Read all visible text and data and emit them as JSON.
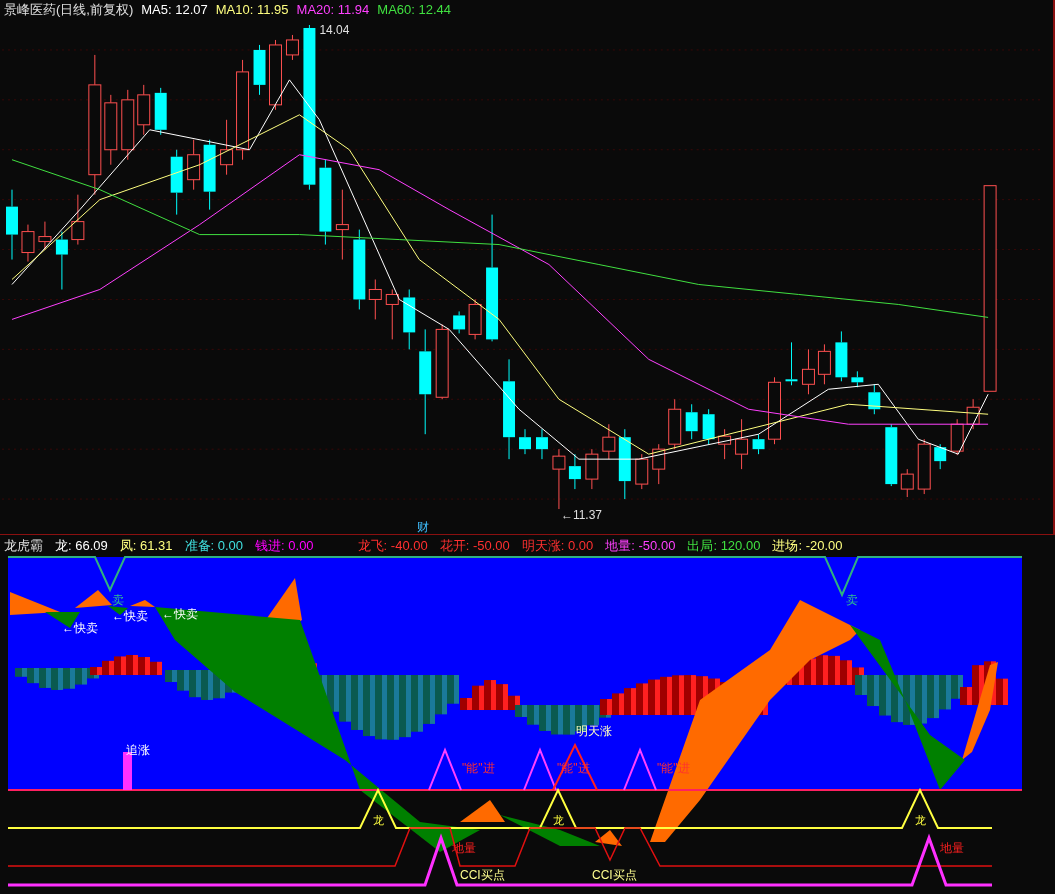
{
  "main_chart": {
    "title": "景峰医药(日线,前复权)",
    "indicators": [
      {
        "label": "MA5: 12.07",
        "color": "#ffffff"
      },
      {
        "label": "MA10: 11.95",
        "color": "#ffff80"
      },
      {
        "label": "MA20: 11.94",
        "color": "#ff40ff"
      },
      {
        "label": "MA60: 12.44",
        "color": "#40e040"
      }
    ],
    "annotations": [
      {
        "kind": "high",
        "text": "14.04"
      },
      {
        "kind": "low",
        "text": "←11.37"
      },
      {
        "kind": "event",
        "text": "财"
      }
    ]
  },
  "sub_chart": {
    "title": "龙虎霸",
    "indicators": [
      {
        "label": "龙: 66.09",
        "color": "#ffffff"
      },
      {
        "label": "凤: 61.31",
        "color": "#ffff80"
      },
      {
        "label": "准备: 0.00",
        "color": "#40e0e0"
      },
      {
        "label": "钱进: 0.00",
        "color": "#ff00ff"
      },
      {
        "label": "龙飞: -40.00",
        "color": "#ff3030"
      },
      {
        "label": "花开: -50.00",
        "color": "#ff3030"
      },
      {
        "label": "明天涨: 0.00",
        "color": "#ff3030"
      },
      {
        "label": "地量: -50.00",
        "color": "#ff40ff"
      },
      {
        "label": "出局: 120.00",
        "color": "#40e040"
      },
      {
        "label": "进场: -20.00",
        "color": "#ffff80"
      }
    ],
    "signals": [
      {
        "kind": "sell",
        "text": "卖"
      },
      {
        "kind": "sell",
        "text": "卖"
      },
      {
        "kind": "quick_sell",
        "text": "←快卖"
      },
      {
        "kind": "quick_sell",
        "text": "←快卖"
      },
      {
        "kind": "quick_sell",
        "text": "←快卖"
      },
      {
        "kind": "chase",
        "text": "追涨"
      },
      {
        "kind": "tomorrow",
        "text": "明天涨"
      },
      {
        "kind": "enter",
        "text": "\"能\"进"
      },
      {
        "kind": "enter",
        "text": "\"能\"进"
      },
      {
        "kind": "enter",
        "text": "\"能\"进"
      },
      {
        "kind": "dragon",
        "text": "龙"
      },
      {
        "kind": "dragon",
        "text": "龙"
      },
      {
        "kind": "dragon",
        "text": "龙"
      },
      {
        "kind": "low_volume",
        "text": "地量"
      },
      {
        "kind": "low_volume",
        "text": "地量"
      },
      {
        "kind": "cci_buy",
        "text": "CCI买点"
      },
      {
        "kind": "cci_buy",
        "text": "CCI买点"
      }
    ]
  }
}
